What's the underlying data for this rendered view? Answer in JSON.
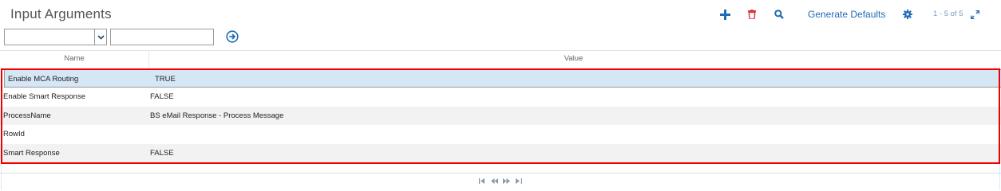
{
  "header": {
    "title": "Input Arguments",
    "generate_defaults_label": "Generate Defaults",
    "record_count": "1 - 5 of 5",
    "icons": [
      "plus-icon",
      "trash-icon",
      "search-icon",
      "gear-icon",
      "expand-icon"
    ]
  },
  "filter": {
    "field_value": "",
    "query_value": ""
  },
  "columns": {
    "name": "Name",
    "value": "Value"
  },
  "rows": [
    {
      "name": "Enable MCA Routing",
      "value": "TRUE",
      "selected": true
    },
    {
      "name": "Enable Smart Response",
      "value": "FALSE"
    },
    {
      "name": "ProcessName",
      "value": "BS eMail Response - Process Message"
    },
    {
      "name": "RowId",
      "value": ""
    },
    {
      "name": "Smart Response",
      "value": "FALSE"
    }
  ],
  "pager": {
    "first": "⏮",
    "prev": "◀◀",
    "next": "▶▶",
    "last": "⏭"
  },
  "colors": {
    "accent": "#1f6bb4",
    "delete": "#d9363e",
    "selected_row": "#d5e6f5",
    "highlight_border": "#ee0000"
  }
}
